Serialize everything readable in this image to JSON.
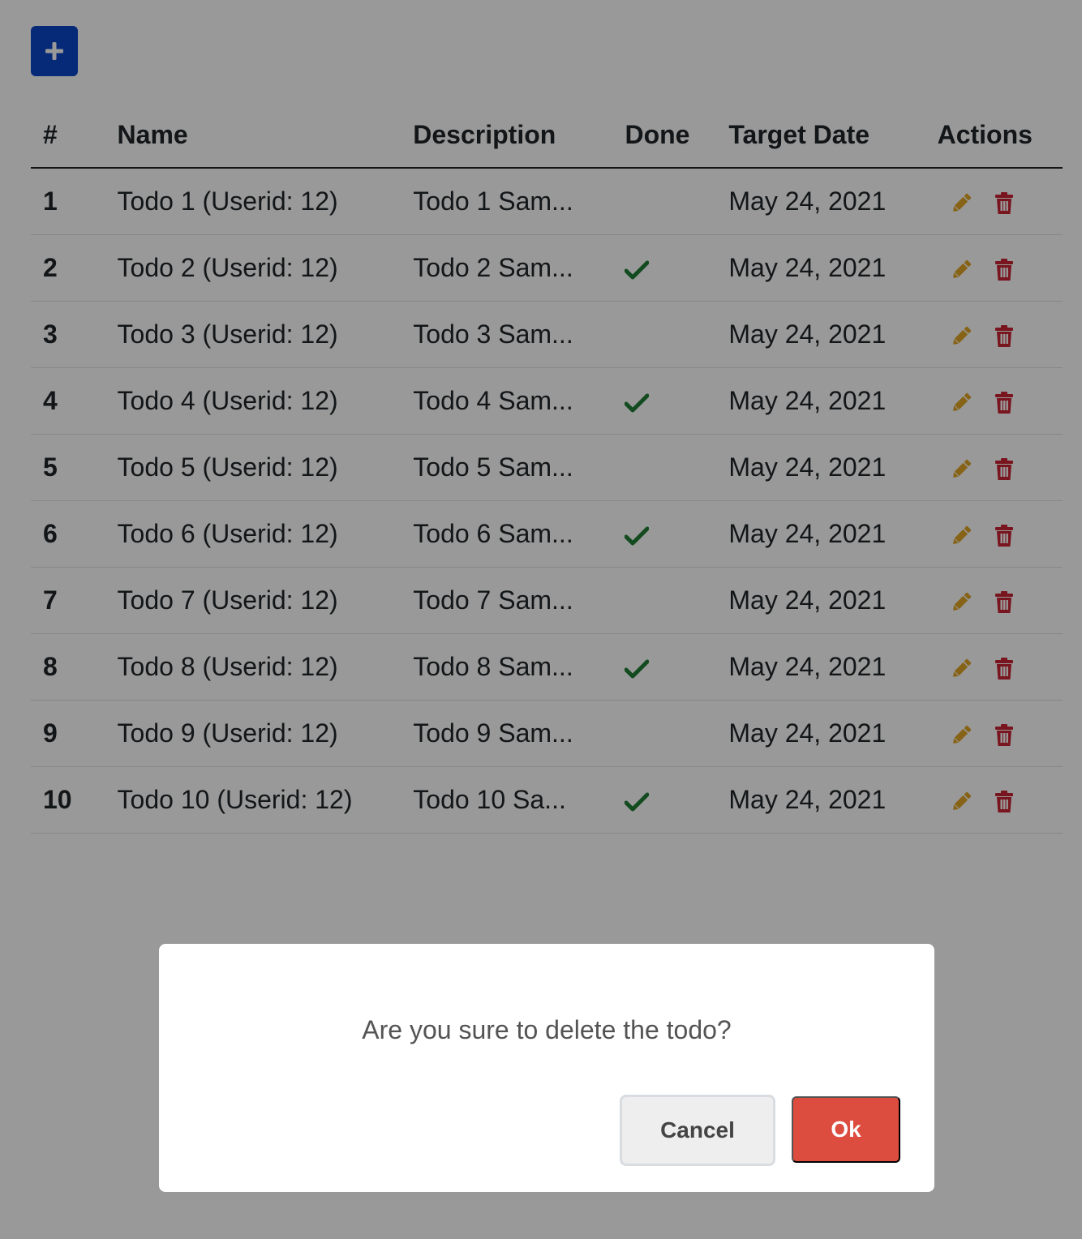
{
  "toolbar": {
    "add_icon": "plus-icon",
    "add_color": "#0d47c9"
  },
  "table": {
    "headers": {
      "num": "#",
      "name": "Name",
      "description": "Description",
      "done": "Done",
      "target_date": "Target Date",
      "actions": "Actions"
    },
    "rows": [
      {
        "num": "1",
        "name": "Todo 1 (Userid: 12)",
        "description": "Todo 1 Sam...",
        "done": false,
        "target_date": "May 24, 2021"
      },
      {
        "num": "2",
        "name": "Todo 2 (Userid: 12)",
        "description": "Todo 2 Sam...",
        "done": true,
        "target_date": "May 24, 2021"
      },
      {
        "num": "3",
        "name": "Todo 3 (Userid: 12)",
        "description": "Todo 3 Sam...",
        "done": false,
        "target_date": "May 24, 2021"
      },
      {
        "num": "4",
        "name": "Todo 4 (Userid: 12)",
        "description": "Todo 4 Sam...",
        "done": true,
        "target_date": "May 24, 2021"
      },
      {
        "num": "5",
        "name": "Todo 5 (Userid: 12)",
        "description": "Todo 5 Sam...",
        "done": false,
        "target_date": "May 24, 2021"
      },
      {
        "num": "6",
        "name": "Todo 6 (Userid: 12)",
        "description": "Todo 6 Sam...",
        "done": true,
        "target_date": "May 24, 2021"
      },
      {
        "num": "7",
        "name": "Todo 7 (Userid: 12)",
        "description": "Todo 7 Sam...",
        "done": false,
        "target_date": "May 24, 2021"
      },
      {
        "num": "8",
        "name": "Todo 8 (Userid: 12)",
        "description": "Todo 8 Sam...",
        "done": true,
        "target_date": "May 24, 2021"
      },
      {
        "num": "9",
        "name": "Todo 9 (Userid: 12)",
        "description": "Todo 9 Sam...",
        "done": false,
        "target_date": "May 24, 2021"
      },
      {
        "num": "10",
        "name": "Todo 10 (Userid: 12)",
        "description": "Todo 10 Sa...",
        "done": true,
        "target_date": "May 24, 2021"
      }
    ],
    "icons": {
      "done": "check-icon",
      "edit": "pencil-icon",
      "delete": "trash-icon"
    },
    "colors": {
      "done": "#1e7e34",
      "edit": "#e0a526",
      "delete": "#c82333"
    }
  },
  "dialog": {
    "message": "Are you sure to delete the todo?",
    "cancel_label": "Cancel",
    "ok_label": "Ok",
    "ok_color": "#dc4c3f",
    "overlay": "rgba(0,0,0,0.4)"
  }
}
